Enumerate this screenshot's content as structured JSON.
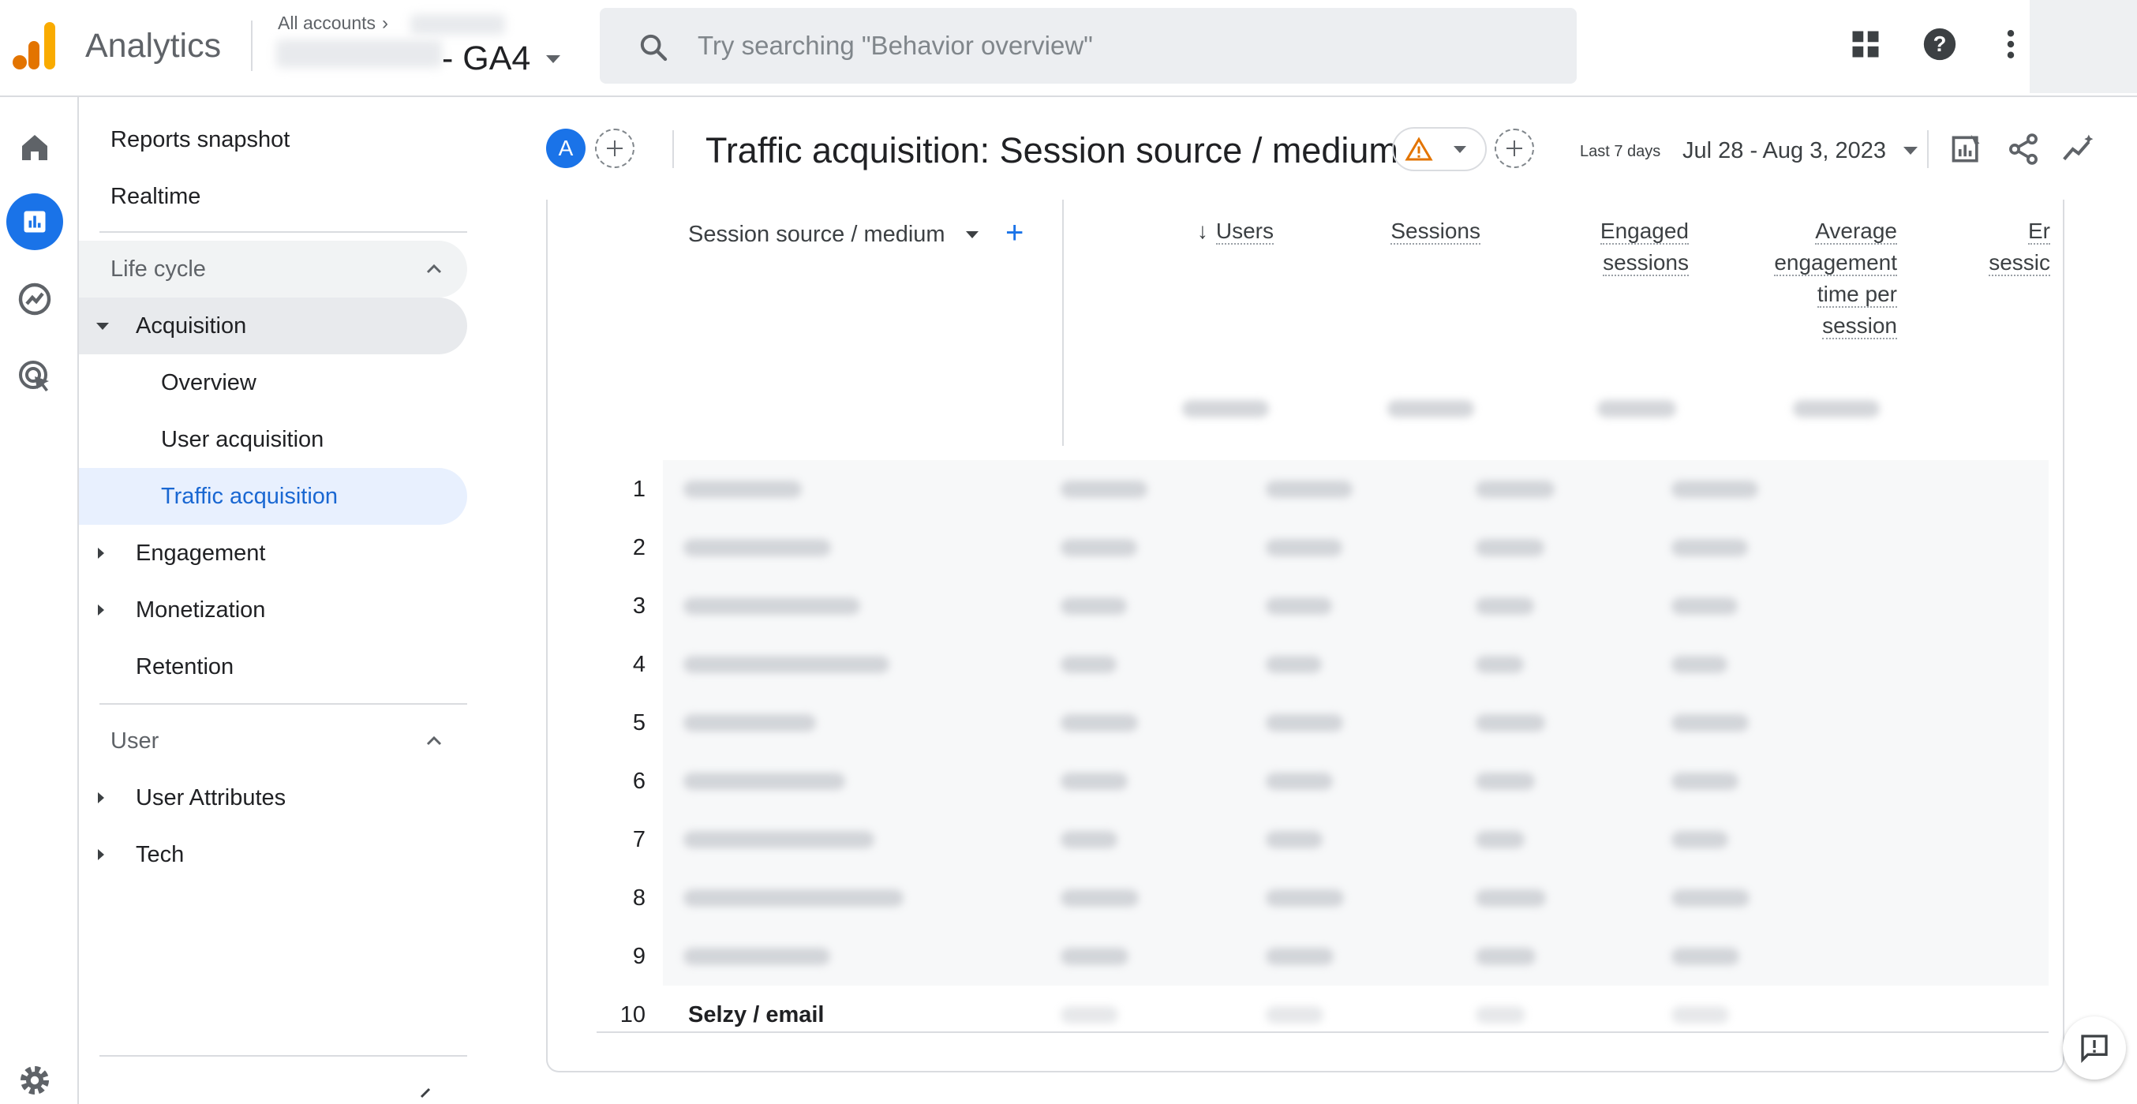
{
  "app": {
    "name": "Analytics"
  },
  "account": {
    "crumb_label": "All accounts",
    "property_name": "- GA4"
  },
  "search": {
    "placeholder": "Try searching \"Behavior overview\""
  },
  "topbar_icons": [
    "apps-grid-icon",
    "help-icon",
    "more-vert-icon"
  ],
  "rail": {
    "icons": [
      "home-icon",
      "reports-icon",
      "explore-icon",
      "advertising-icon",
      "settings-icon"
    ]
  },
  "sidebar": {
    "top_items": [
      {
        "label": "Reports snapshot"
      },
      {
        "label": "Realtime"
      }
    ],
    "lifecycle": {
      "title": "Life cycle",
      "acquisition": {
        "label": "Acquisition",
        "children": [
          {
            "label": "Overview"
          },
          {
            "label": "User acquisition"
          },
          {
            "label": "Traffic acquisition",
            "selected": true
          }
        ]
      },
      "others": [
        {
          "label": "Engagement"
        },
        {
          "label": "Monetization"
        },
        {
          "label": "Retention"
        }
      ]
    },
    "user": {
      "title": "User",
      "items": [
        {
          "label": "User Attributes"
        },
        {
          "label": "Tech"
        }
      ]
    }
  },
  "report": {
    "compare_badge": "A",
    "title": "Traffic acquisition: Session source / medium",
    "date_preset": "Last 7 days",
    "date_range": "Jul 28 - Aug 3, 2023"
  },
  "table": {
    "dimension_header": "Session source / medium",
    "dimension_add": "+",
    "metrics": [
      {
        "lines": [
          "Users"
        ],
        "sorted": true
      },
      {
        "lines": [
          "Sessions"
        ]
      },
      {
        "lines": [
          "Engaged",
          "sessions"
        ]
      },
      {
        "lines": [
          "Average",
          "engagement",
          "time per",
          "session"
        ]
      },
      {
        "lines": [
          "Er",
          "sessic"
        ]
      }
    ],
    "rows": [
      {
        "index": "1",
        "name": ""
      },
      {
        "index": "2",
        "name": ""
      },
      {
        "index": "3",
        "name": ""
      },
      {
        "index": "4",
        "name": ""
      },
      {
        "index": "5",
        "name": ""
      },
      {
        "index": "6",
        "name": ""
      },
      {
        "index": "7",
        "name": ""
      },
      {
        "index": "8",
        "name": ""
      },
      {
        "index": "9",
        "name": ""
      },
      {
        "index": "10",
        "name": "Selzy / email"
      }
    ]
  },
  "colors": {
    "accent": "#1a73e8",
    "selected_bg": "#e8f0fe",
    "warning": "#e37400"
  }
}
